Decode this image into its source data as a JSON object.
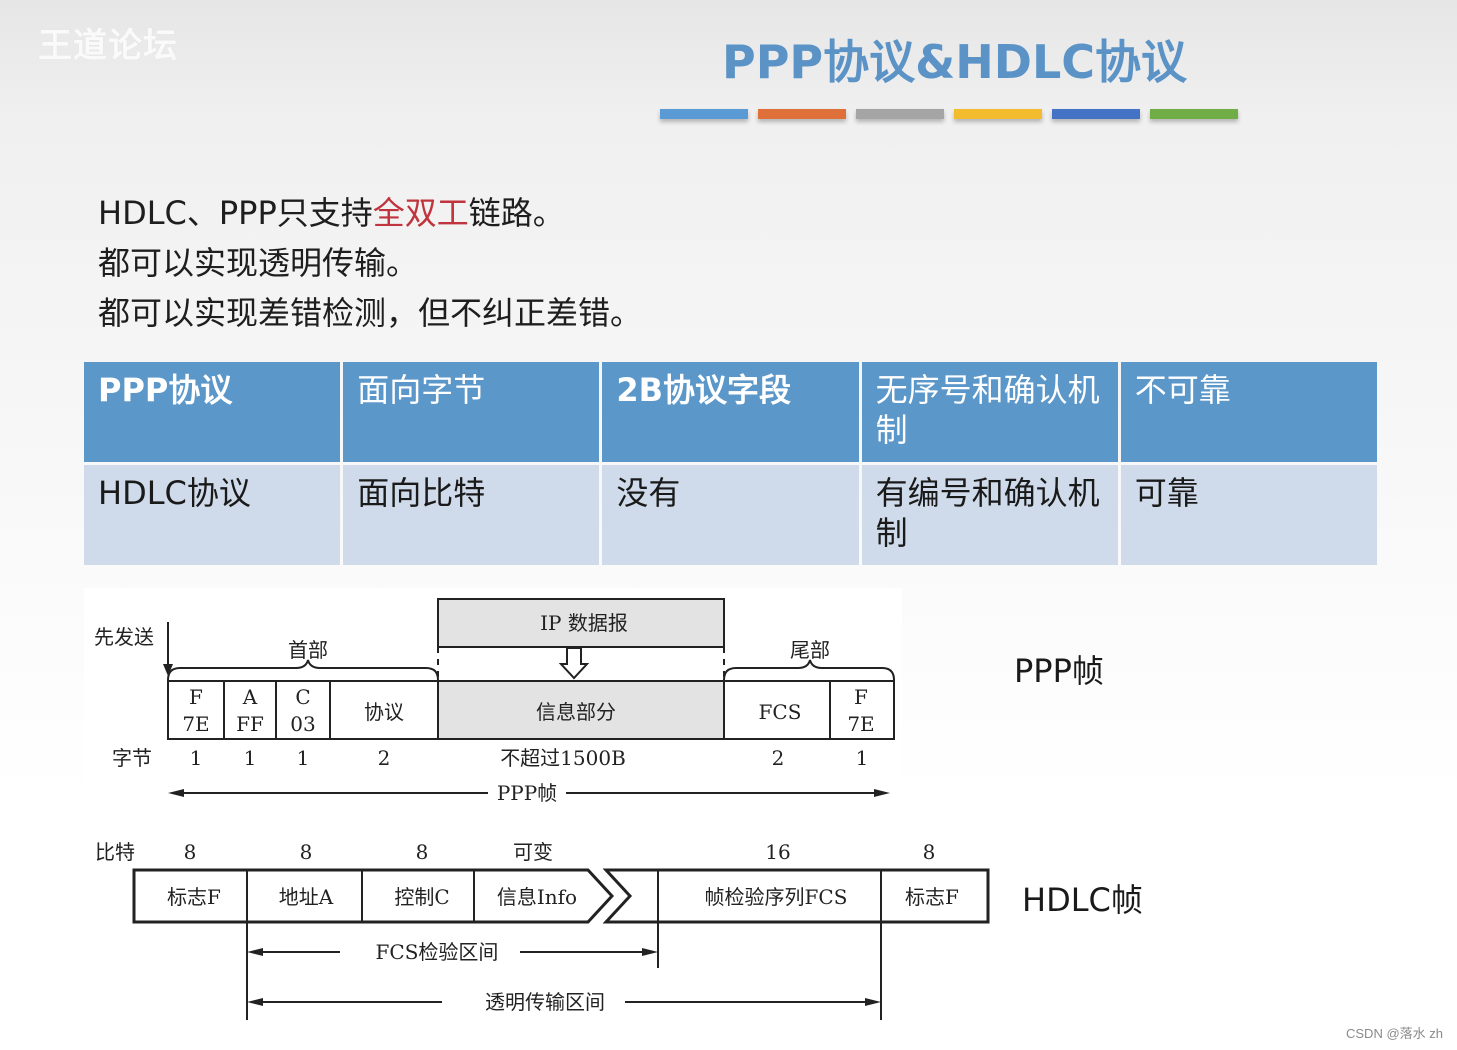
{
  "header": {
    "logo_text": "王道论坛",
    "title": "PPP协议&HDLC协议",
    "color_bars": [
      "#5b9bd5",
      "#e0703a",
      "#a5a5a5",
      "#f2bc2e",
      "#4472c4",
      "#70ad47"
    ]
  },
  "intro": {
    "line1_prefix": "HDLC、PPP只支持",
    "line1_highlight": "全双工",
    "line1_suffix": "链路。",
    "line2": "都可以实现透明传输。",
    "line3": "都可以实现差错检测，但不纠正差错。",
    "highlight_color": "#c0353d"
  },
  "comparison_table": {
    "rows": [
      [
        "PPP协议",
        "面向字节",
        "2B协议字段",
        "无序号和确认机制",
        "不可靠"
      ],
      [
        "HDLC协议",
        "面向比特",
        "没有",
        "有编号和确认机制",
        "可靠"
      ]
    ]
  },
  "ppp_frame": {
    "side_label": "PPP帧",
    "send_first_label": "先发送",
    "header_brace_label": "首部",
    "trailer_brace_label": "尾部",
    "ip_datagram_label": "IP 数据报",
    "fields": [
      {
        "line1": "F",
        "line2": "7E",
        "bytes": "1"
      },
      {
        "line1": "A",
        "line2": "FF",
        "bytes": "1"
      },
      {
        "line1": "C",
        "line2": "03",
        "bytes": "1"
      },
      {
        "line1": "协议",
        "line2": "",
        "bytes": "2"
      },
      {
        "line1": "信息部分",
        "line2": "",
        "bytes": "不超过1500B"
      },
      {
        "line1": "FCS",
        "line2": "",
        "bytes": "2"
      },
      {
        "line1": "F",
        "line2": "7E",
        "bytes": "1"
      }
    ],
    "bytes_row_label": "字节",
    "span_label": "PPP帧"
  },
  "hdlc_frame": {
    "side_label": "HDLC帧",
    "bits_row_label": "比特",
    "fields": [
      {
        "label": "标志F",
        "bits": "8"
      },
      {
        "label": "地址A",
        "bits": "8"
      },
      {
        "label": "控制C",
        "bits": "8"
      },
      {
        "label": "信息Info",
        "bits": "可变"
      },
      {
        "label": "帧检验序列FCS",
        "bits": "16"
      },
      {
        "label": "标志F",
        "bits": "8"
      }
    ],
    "fcs_range_label": "FCS检验区间",
    "transparent_range_label": "透明传输区间"
  },
  "credit": "CSDN @落水 zh"
}
